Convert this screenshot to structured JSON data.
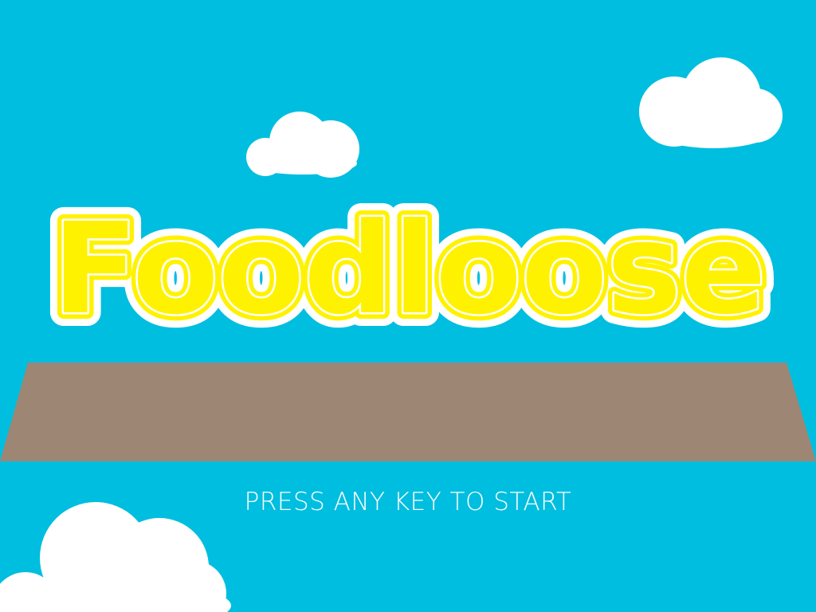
{
  "game": {
    "title": "Foodloose",
    "prompt": "PRESS ANY KEY TO START"
  },
  "colors": {
    "sky": "#00bedf",
    "cloud": "#ffffff",
    "title_fill": "#fff200",
    "title_outline": "#ffffff",
    "platform": "#9e8674",
    "prompt_text": "#ffffff"
  }
}
